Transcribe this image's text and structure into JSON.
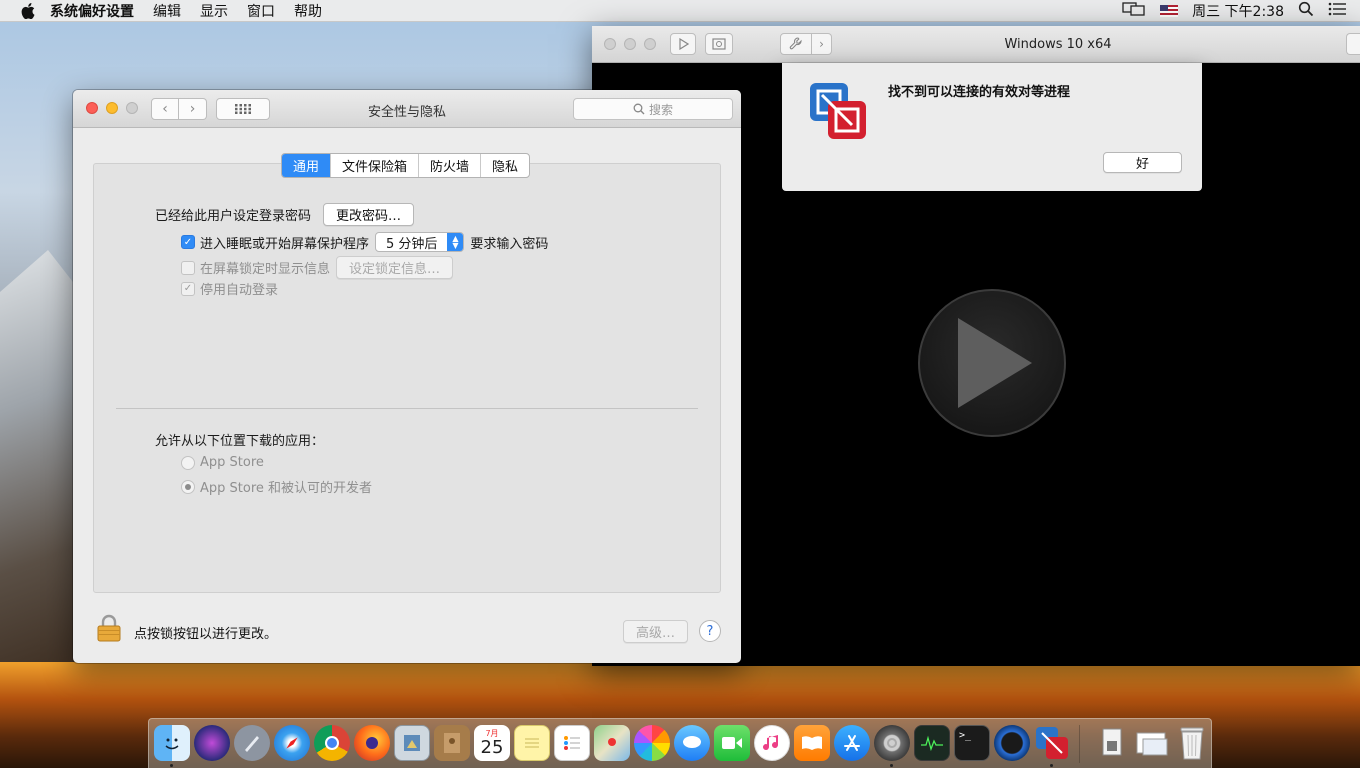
{
  "menubar": {
    "app_name": "系统偏好设置",
    "items": [
      "编辑",
      "显示",
      "窗口",
      "帮助"
    ],
    "clock": "周三 下午2:38",
    "apple_icon": "apple-icon",
    "display_icon": "display-mirroring-icon",
    "input_icon": "us-flag-icon",
    "search_icon": "spotlight-icon",
    "menu_icon": "notification-center-icon"
  },
  "prefs": {
    "title": "安全性与隐私",
    "search_placeholder": "搜索",
    "tabs": [
      {
        "label": "通用",
        "active": true
      },
      {
        "label": "文件保险箱",
        "active": false
      },
      {
        "label": "防火墙",
        "active": false
      },
      {
        "label": "隐私",
        "active": false
      }
    ],
    "password_label": "已经给此用户设定登录密码",
    "change_password_button": "更改密码…",
    "require_password": {
      "checked": true,
      "label_before": "进入睡眠或开始屏幕保护程序",
      "select_value": "5 分钟后",
      "label_after": "要求输入密码"
    },
    "show_message": {
      "checked": false,
      "label": "在屏幕锁定时显示信息",
      "button": "设定锁定信息…"
    },
    "disable_autologin": {
      "checked": true,
      "label": "停用自动登录"
    },
    "downloads_label": "允许从以下位置下载的应用：",
    "download_options": [
      {
        "label": "App Store",
        "selected": false
      },
      {
        "label": "App Store 和被认可的开发者",
        "selected": true
      }
    ],
    "footer_text": "点按锁按钮以进行更改。",
    "advanced_button": "高级…",
    "help_button": "?"
  },
  "vmware": {
    "title": "Windows 10 x64",
    "dialog": {
      "message": "找不到可以连接的有效对等进程",
      "ok_button": "好"
    }
  },
  "dock": {
    "calendar_month": "7月",
    "calendar_day": "25",
    "apps": [
      "finder",
      "siri",
      "launchpad",
      "safari",
      "chrome",
      "firefox",
      "preview",
      "contacts",
      "calendar",
      "notes",
      "reminders",
      "maps",
      "photos",
      "messages",
      "facetime",
      "itunes",
      "ibooks",
      "app-store",
      "system-preferences",
      "activity-monitor",
      "terminal",
      "quicktime",
      "vmware-fusion",
      "downloads",
      "documents",
      "trash"
    ]
  },
  "colors": {
    "accent": "#2f8bf6",
    "close": "#fc5f57",
    "minimize": "#fdbc2e"
  }
}
